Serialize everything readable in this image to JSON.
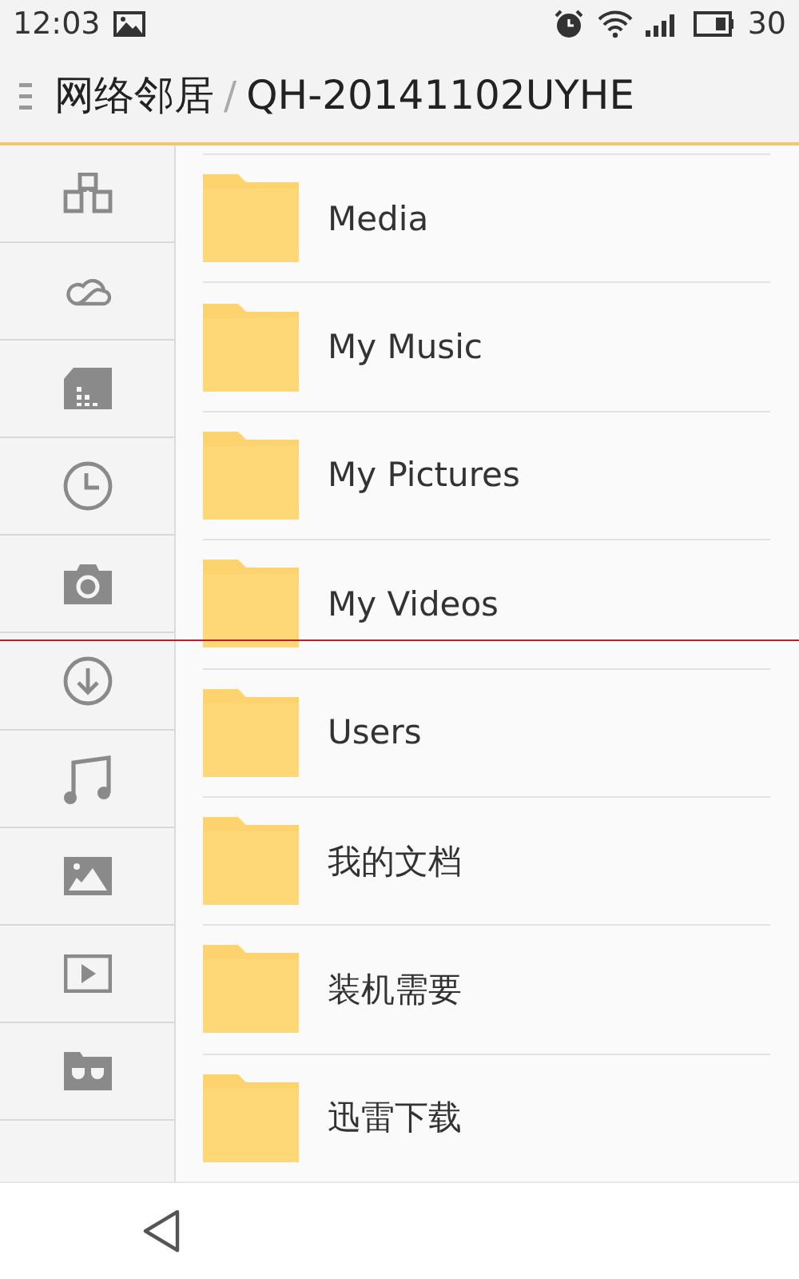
{
  "status_bar": {
    "time": "12:03",
    "battery": "30"
  },
  "title_bar": {
    "path": [
      {
        "label": "网络邻居"
      },
      {
        "label": "QH-20141102UYHE"
      }
    ],
    "separator": "/"
  },
  "folders": [
    {
      "name": "Media"
    },
    {
      "name": "My Music"
    },
    {
      "name": "My Pictures"
    },
    {
      "name": "My Videos"
    },
    {
      "name": "Users"
    },
    {
      "name": "我的文档"
    },
    {
      "name": "装机需要"
    },
    {
      "name": "迅雷下载"
    }
  ]
}
